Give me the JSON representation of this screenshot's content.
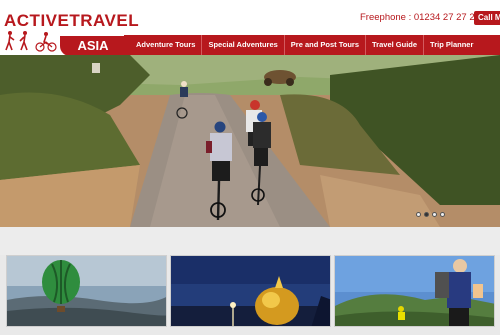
{
  "brand": {
    "name": "ACTIVETRAVEL",
    "sub": "ASIA",
    "color": "#b7181d"
  },
  "contact": {
    "phone_label": "Freephone : 01234 27 27 28",
    "call_label": "Call M"
  },
  "nav": {
    "items": [
      {
        "label": "Adventure Tours"
      },
      {
        "label": "Special Adventures"
      },
      {
        "label": "Pre and Post Tours"
      },
      {
        "label": "Travel Guide"
      },
      {
        "label": "Trip Planner"
      }
    ]
  },
  "hero": {
    "slide_count": 4,
    "active_slide": 2
  },
  "thumbnails": [
    {
      "icon": "hot-air-balloon-image"
    },
    {
      "icon": "golden-rock-pagoda-image"
    },
    {
      "icon": "cyclists-image"
    }
  ]
}
